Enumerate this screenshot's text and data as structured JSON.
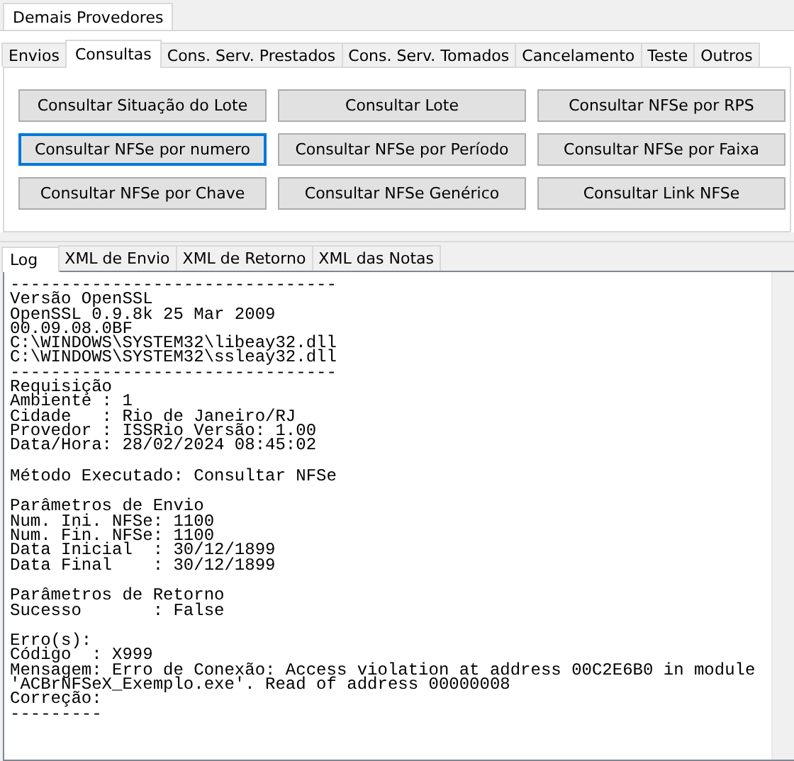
{
  "outer_tabs": [
    {
      "label": "Demais Provedores",
      "selected": true
    }
  ],
  "tabs": [
    {
      "label": "Envios",
      "selected": false
    },
    {
      "label": "Consultas",
      "selected": true
    },
    {
      "label": "Cons. Serv. Prestados",
      "selected": false
    },
    {
      "label": "Cons. Serv. Tomados",
      "selected": false
    },
    {
      "label": "Cancelamento",
      "selected": false
    },
    {
      "label": "Teste",
      "selected": false
    },
    {
      "label": "Outros",
      "selected": false
    }
  ],
  "buttons": [
    {
      "label": "Consultar Situação do Lote",
      "focused": false
    },
    {
      "label": "Consultar Lote",
      "focused": false
    },
    {
      "label": "Consultar NFSe por RPS",
      "focused": false
    },
    {
      "label": "Consultar NFSe por numero",
      "focused": true
    },
    {
      "label": "Consultar NFSe por Período",
      "focused": false
    },
    {
      "label": "Consultar NFSe por Faixa",
      "focused": false
    },
    {
      "label": "Consultar NFSe por Chave",
      "focused": false
    },
    {
      "label": "Consultar NFSe Genérico",
      "focused": false
    },
    {
      "label": "Consultar Link NFSe",
      "focused": false
    }
  ],
  "log_tabs": [
    {
      "label": "Log",
      "selected": true
    },
    {
      "label": "XML de Envio",
      "selected": false
    },
    {
      "label": "XML de Retorno",
      "selected": false
    },
    {
      "label": "XML das Notas",
      "selected": false
    }
  ],
  "log": [
    [
      "--------------------------------",
      "Versão OpenSSL",
      "OpenSSL 0.9.8k 25 Mar 2009",
      "00.09.08.0BF",
      "C:\\WINDOWS\\SYSTEM32\\libeay32.dll",
      "C:\\WINDOWS\\SYSTEM32\\ssleay32.dll",
      "--------------------------------",
      "Requisição",
      "Ambiente : 1",
      "Cidade   : Rio de Janeiro/RJ",
      "Provedor : ISSRio Versão: 1.00",
      "Data/Hora: 28/02/2024 08:45:02"
    ],
    [
      "Método Executado: Consultar NFSe"
    ],
    [
      "Parâmetros de Envio",
      "Num. Ini. NFSe: 1100",
      "Num. Fin. NFSe: 1100",
      "Data Inicial  : 30/12/1899",
      "Data Final    : 30/12/1899"
    ],
    [
      "Parâmetros de Retorno",
      "Sucesso       : False"
    ],
    [
      "Erro(s):",
      "Código  : X999",
      "Mensagem: Erro de Conexão: Access violation at address 00C2E6B0 in module",
      "'ACBrNFSeX_Exemplo.exe'. Read of address 00000008",
      "Correção:",
      "---------"
    ]
  ]
}
